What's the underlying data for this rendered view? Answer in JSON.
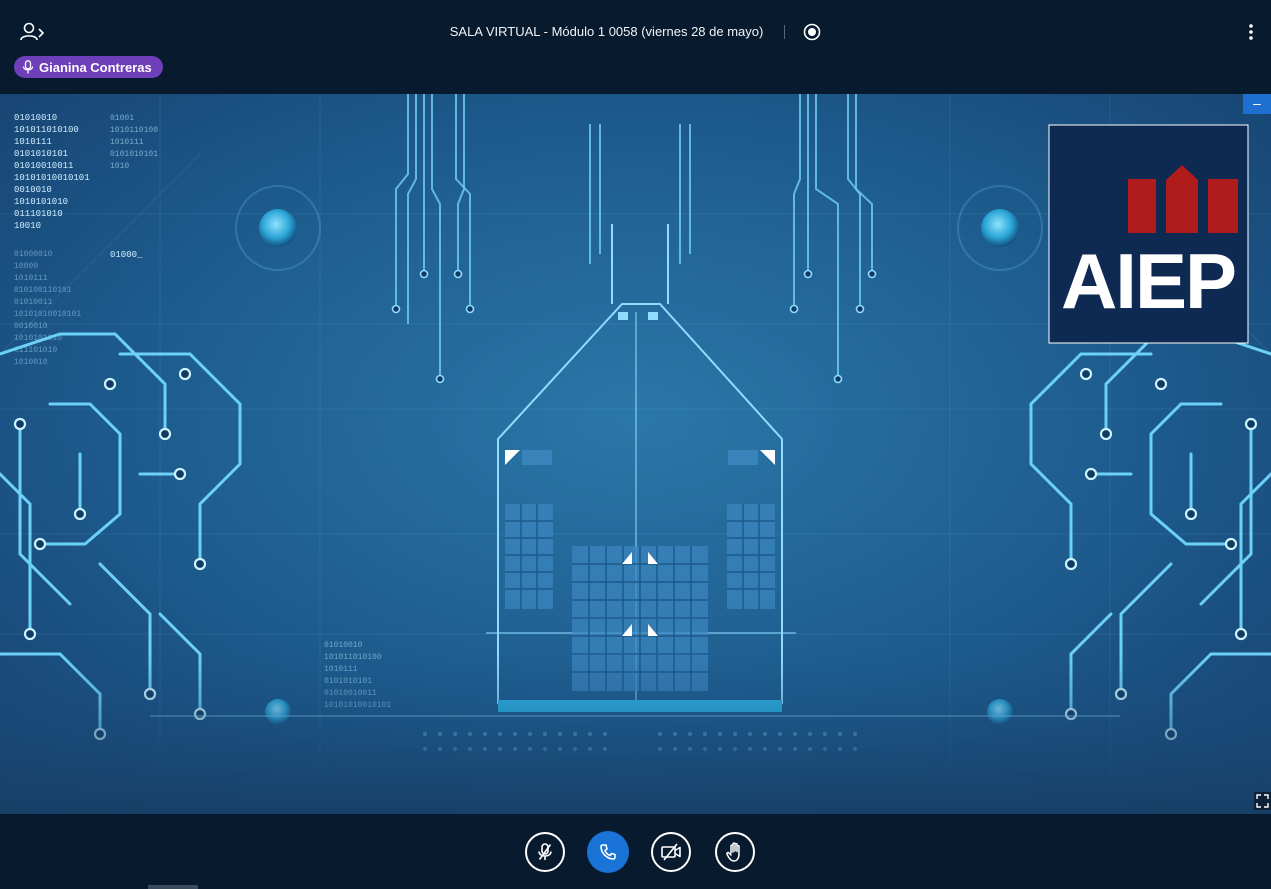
{
  "header": {
    "title": "SALA VIRTUAL - Módulo 1 0058 (viernes 28 de mayo)",
    "icons": {
      "users": "users-toggle-icon",
      "recording": "record-icon",
      "options": "more-vertical-icon"
    }
  },
  "talking_indicator": {
    "name": "Gianina Contreras",
    "icon": "microphone-icon"
  },
  "presentation": {
    "logo_text": "AIEP",
    "minimize_label": "–",
    "binary_left": [
      "01010010",
      "101011010100",
      "1010111",
      "0101010101",
      "01010010011",
      "10101010010101",
      "0010010",
      "1010101010",
      "011101010",
      "10010"
    ],
    "binary_left2": [
      "01001",
      "1010110100",
      "1010111",
      "0101010101",
      "1010"
    ],
    "binary_left3": [
      "01000010",
      "10000",
      "1010111",
      "010100110101",
      "01010011",
      "10101010010101",
      "0010010",
      "1010101010",
      "011101010",
      "1010010"
    ],
    "binary_code_low": [
      "01010010",
      "101011010100",
      "1010111",
      "0101010101",
      "01010010011",
      "10101010010101"
    ],
    "code_tag": "01000_"
  },
  "controls": {
    "buttons": [
      {
        "name": "mute-microphone",
        "icon": "microphone-off-icon"
      },
      {
        "name": "leave-audio",
        "icon": "phone-icon"
      },
      {
        "name": "share-webcam",
        "icon": "video-off-icon"
      },
      {
        "name": "raise-hand",
        "icon": "hand-icon"
      }
    ]
  },
  "colors": {
    "topbar": "#081a2e",
    "talker_badge": "#6e3fb9",
    "hangup": "#1a73d6",
    "logo_bg": "#0f2a52",
    "logo_red": "#b01c1c"
  }
}
